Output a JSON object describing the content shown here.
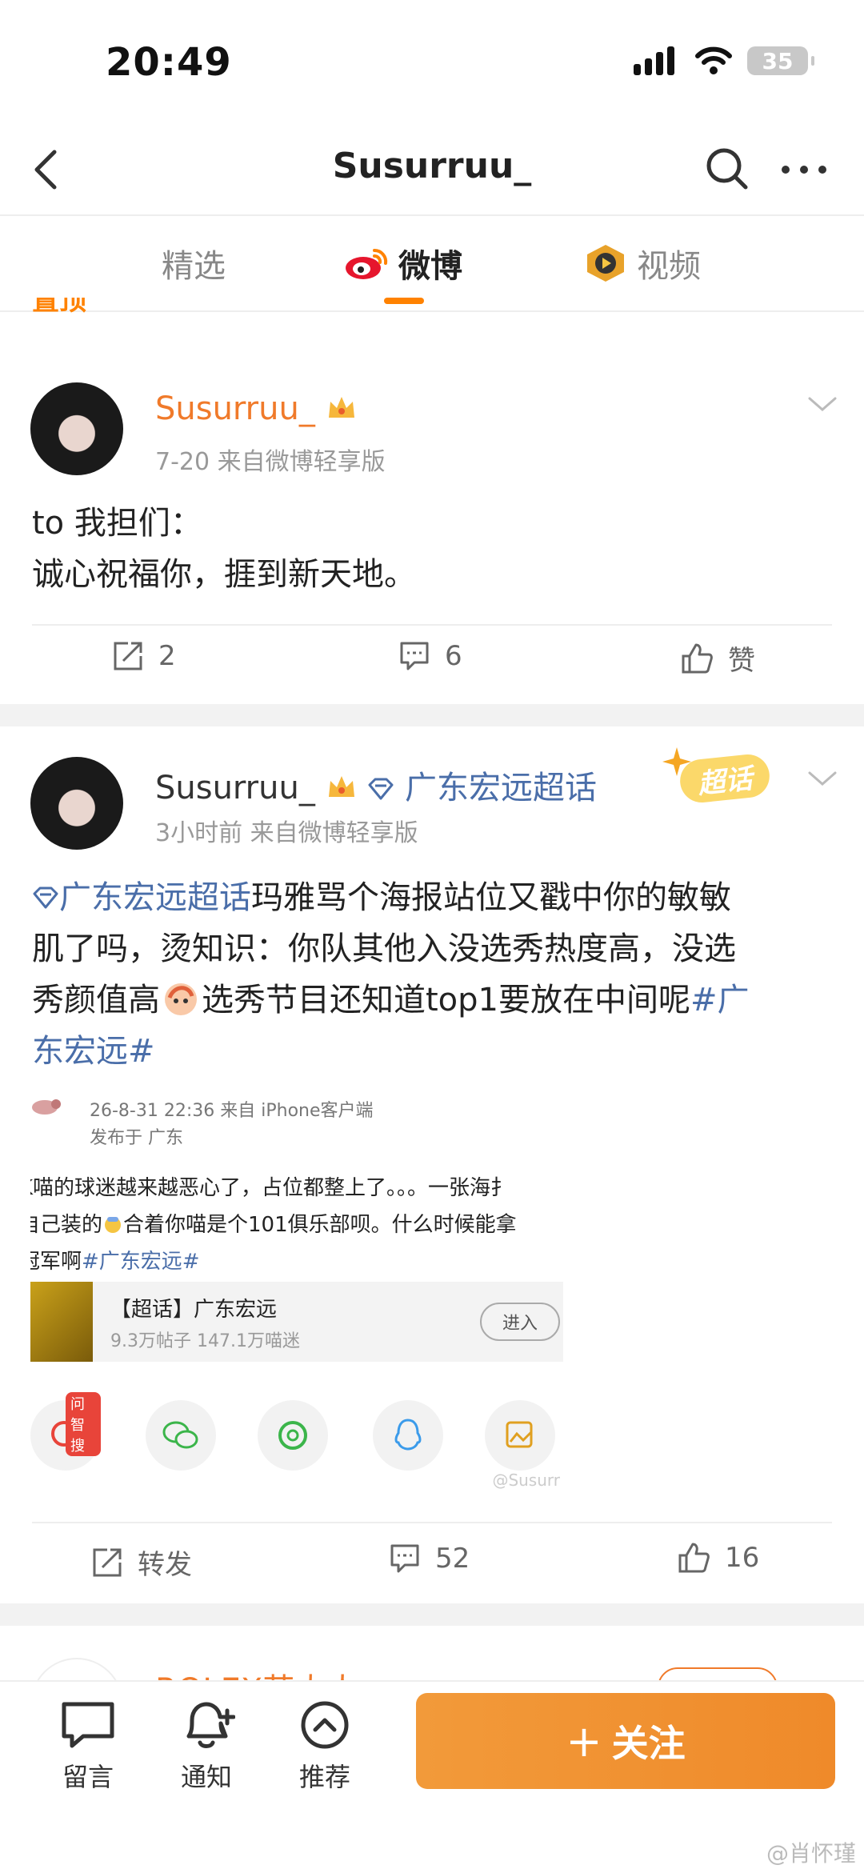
{
  "status_bar": {
    "time": "20:49",
    "battery": "35"
  },
  "header": {
    "title": "Susurruu_"
  },
  "tabs": [
    {
      "label": "精选"
    },
    {
      "label": "微博"
    },
    {
      "label": "视频"
    }
  ],
  "pinned": {
    "label": "置顶"
  },
  "post1": {
    "username": "Susurruu_",
    "meta": "7-20  来自微博轻享版",
    "lines": [
      "to 我担们：",
      "诚心祝福你，捱到新天地。"
    ],
    "repost_count": "2",
    "comment_count": "6",
    "like_label": "赞"
  },
  "post2": {
    "username": "Susurruu_",
    "topic_tag": "广东宏远超话",
    "meta": "3小时前  来自微博轻享版",
    "badge": "超话",
    "text_topic": "广东宏远超话",
    "line1_rest": "玛雅骂个海报站位又戳中你的敏敏",
    "line2": "肌了吗，烫知识：你队其他入没选秀热度高，没选",
    "line3_a": "秀颜值高",
    "line3_b": "选秀节目还知道top1要放在中间呢",
    "line3_tag": "#广",
    "line4_tag": "东宏远#",
    "embed": {
      "meta1": "26-8-31 22:36  来自 iPhone客户端",
      "meta2": "发布于 广东",
      "text1": "K喵的球迷越来越恶心了，占位都整上了。。。一张海扌",
      "text2": "自己装的",
      "text2b": "合着你喵是个101俱乐部呗。什么时候能拿",
      "text3": "冠军啊",
      "text3_tag": "#广东宏远#",
      "card_title": "【超话】广东宏远",
      "card_sub": "9.3万帖子 147.1万喵迷",
      "card_btn": "进入",
      "ai_badge": "问智搜",
      "watermark": "@Susurr"
    },
    "repost_label": "转发",
    "comment_count": "52",
    "like_count": "16"
  },
  "post3_peek": {
    "username": "ROLEX苏大人"
  },
  "bottom_bar": {
    "message": "留言",
    "notify": "通知",
    "recommend": "推荐",
    "follow": "关注"
  },
  "watermark": "@肖怀瑾"
}
